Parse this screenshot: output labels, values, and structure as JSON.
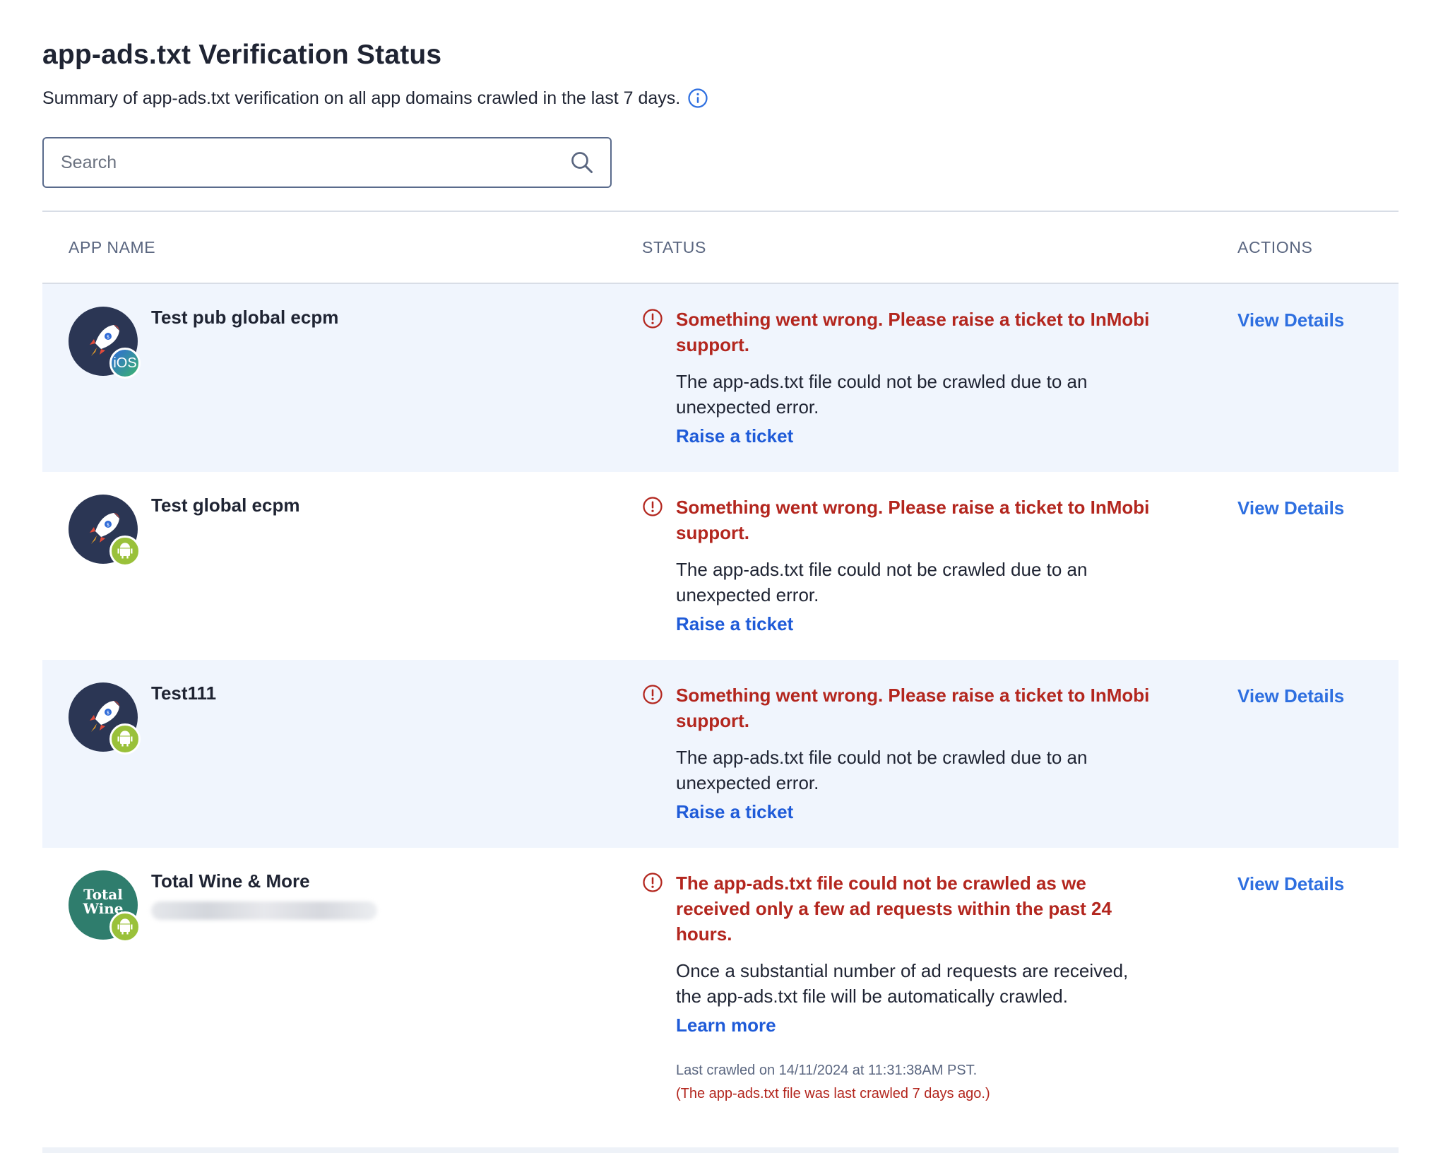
{
  "page": {
    "title": "app-ads.txt Verification Status",
    "subtitle": "Summary of app-ads.txt verification on all app domains crawled in the last 7 days."
  },
  "search": {
    "placeholder": "Search",
    "value": ""
  },
  "table": {
    "headers": {
      "app": "APP NAME",
      "status": "STATUS",
      "actions": "ACTIONS"
    },
    "rows": [
      {
        "app_name": "Test pub global ecpm",
        "platform": "iOS",
        "status_title": "Something went wrong. Please raise a ticket to InMobi support.",
        "status_desc": "The app-ads.txt file could not be crawled due to an unexpected error.",
        "status_link": "Raise a ticket",
        "action": "View Details"
      },
      {
        "app_name": "Test global ecpm",
        "platform": "android",
        "status_title": "Something went wrong. Please raise a ticket to InMobi support.",
        "status_desc": "The app-ads.txt file could not be crawled due to an unexpected error.",
        "status_link": "Raise a ticket",
        "action": "View Details"
      },
      {
        "app_name": "Test111",
        "platform": "android",
        "status_title": "Something went wrong. Please raise a ticket to InMobi support.",
        "status_desc": "The app-ads.txt file could not be crawled due to an unexpected error.",
        "status_link": "Raise a ticket",
        "action": "View Details"
      },
      {
        "app_name": "Total Wine & More",
        "avatar_text": "Total Wine",
        "platform": "android",
        "status_title": "The app-ads.txt file could not be crawled as we received only a few ad requests within the past 24 hours.",
        "status_desc": "Once a substantial number of ad requests are received, the app-ads.txt file will be automatically crawled.",
        "status_link": "Learn more",
        "last_crawled": "Last crawled on 14/11/2024 at 11:31:38AM PST.",
        "crawl_warning": "(The app-ads.txt file was last crawled 7 days ago.)",
        "action": "View Details"
      }
    ]
  },
  "colors": {
    "error": "#b3261e",
    "link": "#1f5bd8",
    "action": "#2e6fe0",
    "row_shade": "#f0f5fd",
    "avatar_dark": "#2b3654",
    "avatar_wine": "#2f7d6d",
    "android_green": "#9ac13a"
  },
  "icons": {
    "info": "info-circle-icon",
    "search": "magnifier-icon",
    "error": "exclamation-circle-icon",
    "app_avatar": "rocket-icon",
    "ios_badge": "ios-icon",
    "android_badge": "android-icon"
  }
}
